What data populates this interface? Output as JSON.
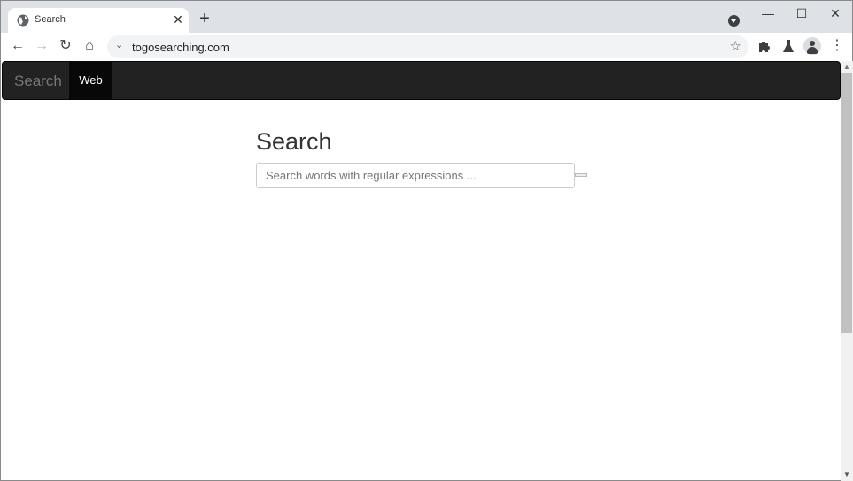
{
  "browser": {
    "tab": {
      "title": "Search",
      "favicon": "globe-icon",
      "close_glyph": "✕"
    },
    "new_tab_glyph": "+",
    "window_controls": {
      "minimize": "—",
      "maximize": "☐",
      "close": "✕"
    },
    "nav": {
      "back": "←",
      "forward": "→",
      "reload": "↻",
      "home": "⌂"
    },
    "omnibox": {
      "chevron": "⌄",
      "url": "togosearching.com",
      "star": "☆"
    },
    "toolbar_icons": {
      "extensions": "puzzle-icon",
      "labs": "flask-icon",
      "profile": "avatar-icon",
      "menu": "⋮"
    }
  },
  "page": {
    "navbar": {
      "brand": "Search",
      "items": [
        {
          "label": "Web",
          "active": true
        }
      ]
    },
    "heading": "Search",
    "search": {
      "placeholder": "Search words with regular expressions ...",
      "value": ""
    }
  },
  "scrollbar": {
    "up": "▲",
    "down": "▼"
  }
}
